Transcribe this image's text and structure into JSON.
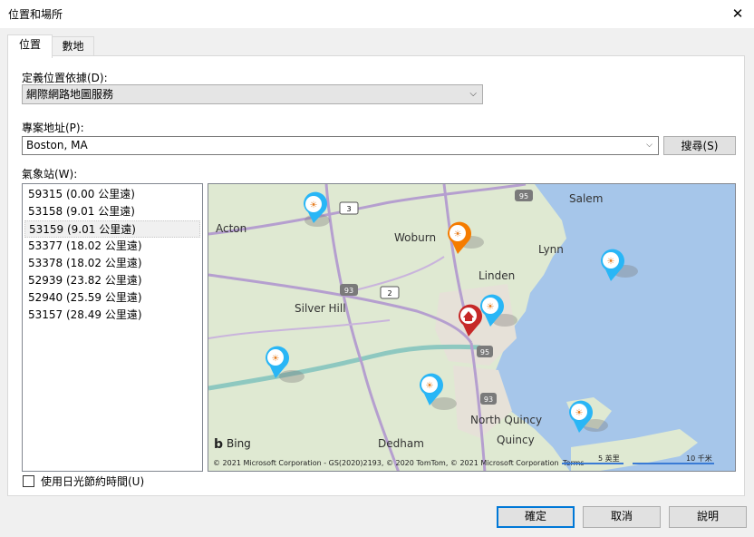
{
  "window": {
    "title": "位置和場所",
    "close_glyph": "✕"
  },
  "tabs": [
    {
      "label": "位置"
    },
    {
      "label": "數地"
    }
  ],
  "location": {
    "define_label": "定義位置依據(D):",
    "define_value": "網際網路地圖服務",
    "address_label": "專案地址(P):",
    "address_value": "Boston, MA",
    "search_label": "搜尋(S)"
  },
  "stations": {
    "label": "氣象站(W):",
    "items": [
      "59315 (0.00 公里遠)",
      "53158 (9.01 公里遠)",
      "53159 (9.01 公里遠)",
      "53377 (18.02 公里遠)",
      "53378 (18.02 公里遠)",
      "52939 (23.82 公里遠)",
      "52940 (25.59 公里遠)",
      "53157 (28.49 公里遠)"
    ],
    "selected_index": 2
  },
  "map": {
    "places": [
      "Salem",
      "Acton",
      "Woburn",
      "Lynn",
      "Linden",
      "Silver Hill",
      "North Quincy",
      "Dedham",
      "Quincy"
    ],
    "route_shields": [
      "95",
      "3",
      "93",
      "2",
      "95",
      "93"
    ],
    "branding": "Bing",
    "copyright": "© 2021 Microsoft Corporation - GS(2020)2193, © 2020 TomTom, © 2021 Microsoft Corporation",
    "terms": "Terms",
    "scale_mi": "5 英里",
    "scale_km": "10 千米"
  },
  "dst": {
    "label": "使用日光節約時間(U)",
    "checked": false
  },
  "buttons": {
    "ok": "確定",
    "cancel": "取消",
    "help": "說明"
  }
}
